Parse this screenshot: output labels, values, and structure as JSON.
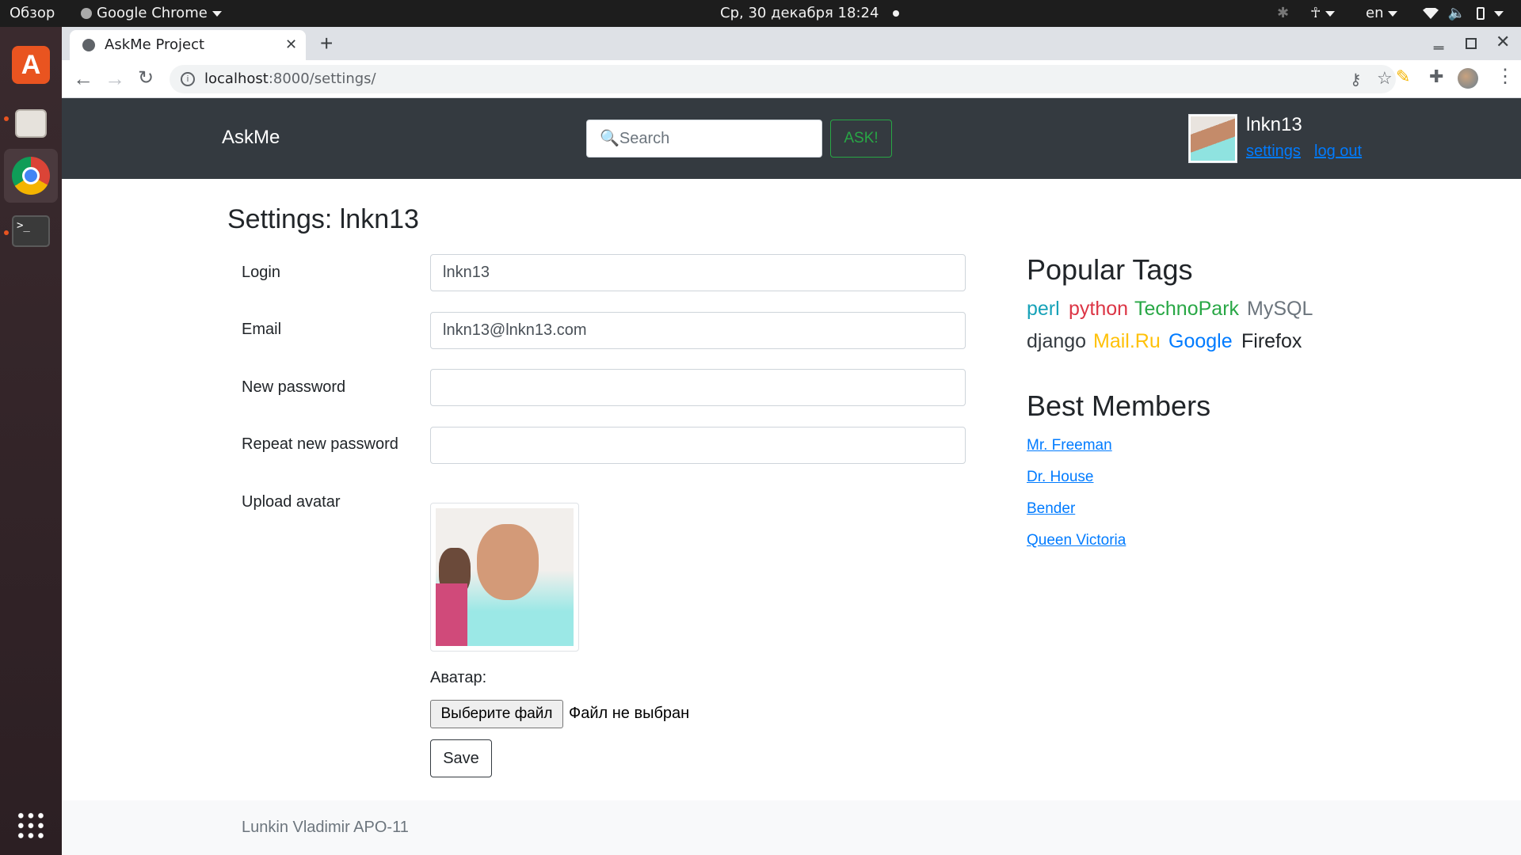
{
  "system_bar": {
    "activities": "Обзор",
    "app_name": "Google Chrome",
    "datetime": "Ср, 30 декабря  18:24",
    "language": "en"
  },
  "browser": {
    "tab_title": "AskMe Project",
    "url_host": "localhost",
    "url_rest": ":8000/settings/"
  },
  "navbar": {
    "brand": "AskMe",
    "search_placeholder": "🔍Search",
    "ask_label": "ASK!",
    "username": "lnkn13",
    "settings_link": "settings",
    "logout_link": "log out"
  },
  "settings": {
    "title": "Settings:  lnkn13",
    "fields": [
      {
        "label": "Login",
        "value": "lnkn13"
      },
      {
        "label": "Email",
        "value": "lnkn13@lnkn13.com"
      },
      {
        "label": "New password",
        "value": ""
      },
      {
        "label": "Repeat new password",
        "value": ""
      }
    ],
    "avatar_label": "Upload avatar",
    "avatar_caption": "Аватар:",
    "choose_file_label": "Выберите файл",
    "no_file_text": "Файл не выбран",
    "save_label": "Save"
  },
  "sidebar": {
    "tags_title": "Popular Tags",
    "tags": [
      {
        "name": "perl",
        "color": "#17a2b8"
      },
      {
        "name": "python",
        "color": "#dc3545"
      },
      {
        "name": "TechnoPark",
        "color": "#28a745"
      },
      {
        "name": "MySQL",
        "color": "#6c757d"
      },
      {
        "name": "django",
        "color": "#343a40"
      },
      {
        "name": "Mail.Ru",
        "color": "#ffc107"
      },
      {
        "name": "Google",
        "color": "#007bff"
      },
      {
        "name": "Firefox",
        "color": "#212529"
      }
    ],
    "members_title": "Best Members",
    "members": [
      "Mr. Freeman",
      "Dr. House",
      "Bender",
      "Queen Victoria"
    ]
  },
  "footer": {
    "text": "Lunkin Vladimir APO-11"
  }
}
